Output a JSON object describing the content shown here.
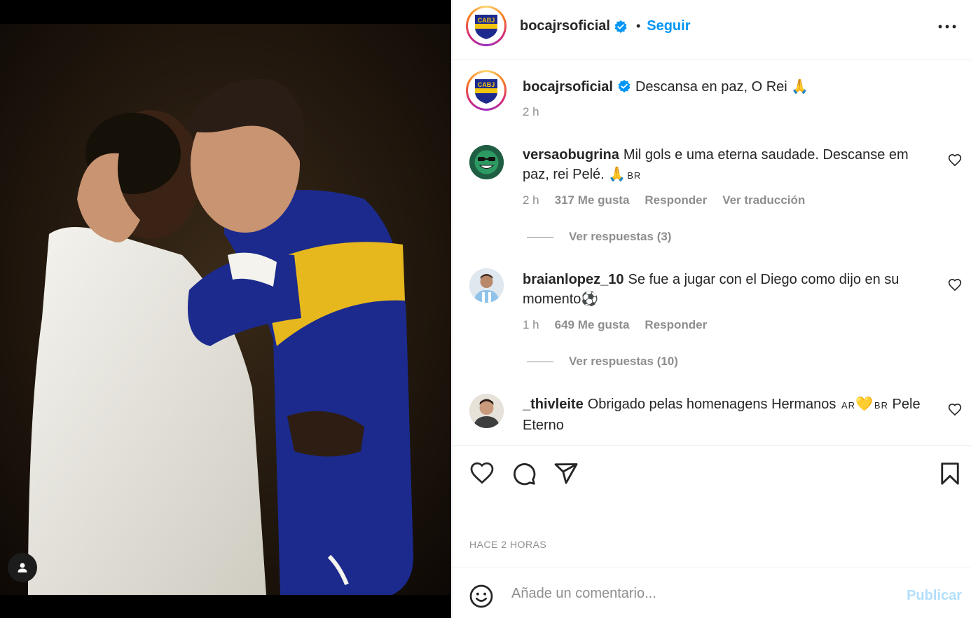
{
  "post": {
    "username": "bocajrsoficial",
    "follow_label": "Seguir",
    "separator": "•",
    "caption": "Descansa en paz, O Rei 🙏",
    "caption_time": "2 h",
    "avatar_text": "CABJ"
  },
  "comments": [
    {
      "username": "versaobugrina",
      "text": "Mil gols e uma eterna saudade. Descanse em paz, rei Pelé. 🙏",
      "flag": "BR",
      "time": "2 h",
      "likes": "317 Me gusta",
      "reply_label": "Responder",
      "translate_label": "Ver traducción",
      "replies_label": "Ver respuestas (3)"
    },
    {
      "username": "braianlopez_10",
      "text": "Se fue a jugar con el Diego como dijo en su momento⚽",
      "time": "1 h",
      "likes": "649 Me gusta",
      "reply_label": "Responder",
      "replies_label": "Ver respuestas (10)"
    },
    {
      "username": "_thivleite",
      "text_a": "Obrigado pelas homenagens Hermanos",
      "flag_a": "AR",
      "emoji": "💛",
      "flag_b": "BR",
      "text_b": "Pele Eterno"
    }
  ],
  "footer": {
    "time_label": "HACE 2 HORAS",
    "comment_placeholder": "Añade un comentario...",
    "publish_label": "Publicar"
  },
  "colors": {
    "accent": "#0095f6",
    "publish_disabled": "#b2dffc",
    "boca_blue": "#1b2a8c",
    "boca_gold": "#f1c40f"
  }
}
